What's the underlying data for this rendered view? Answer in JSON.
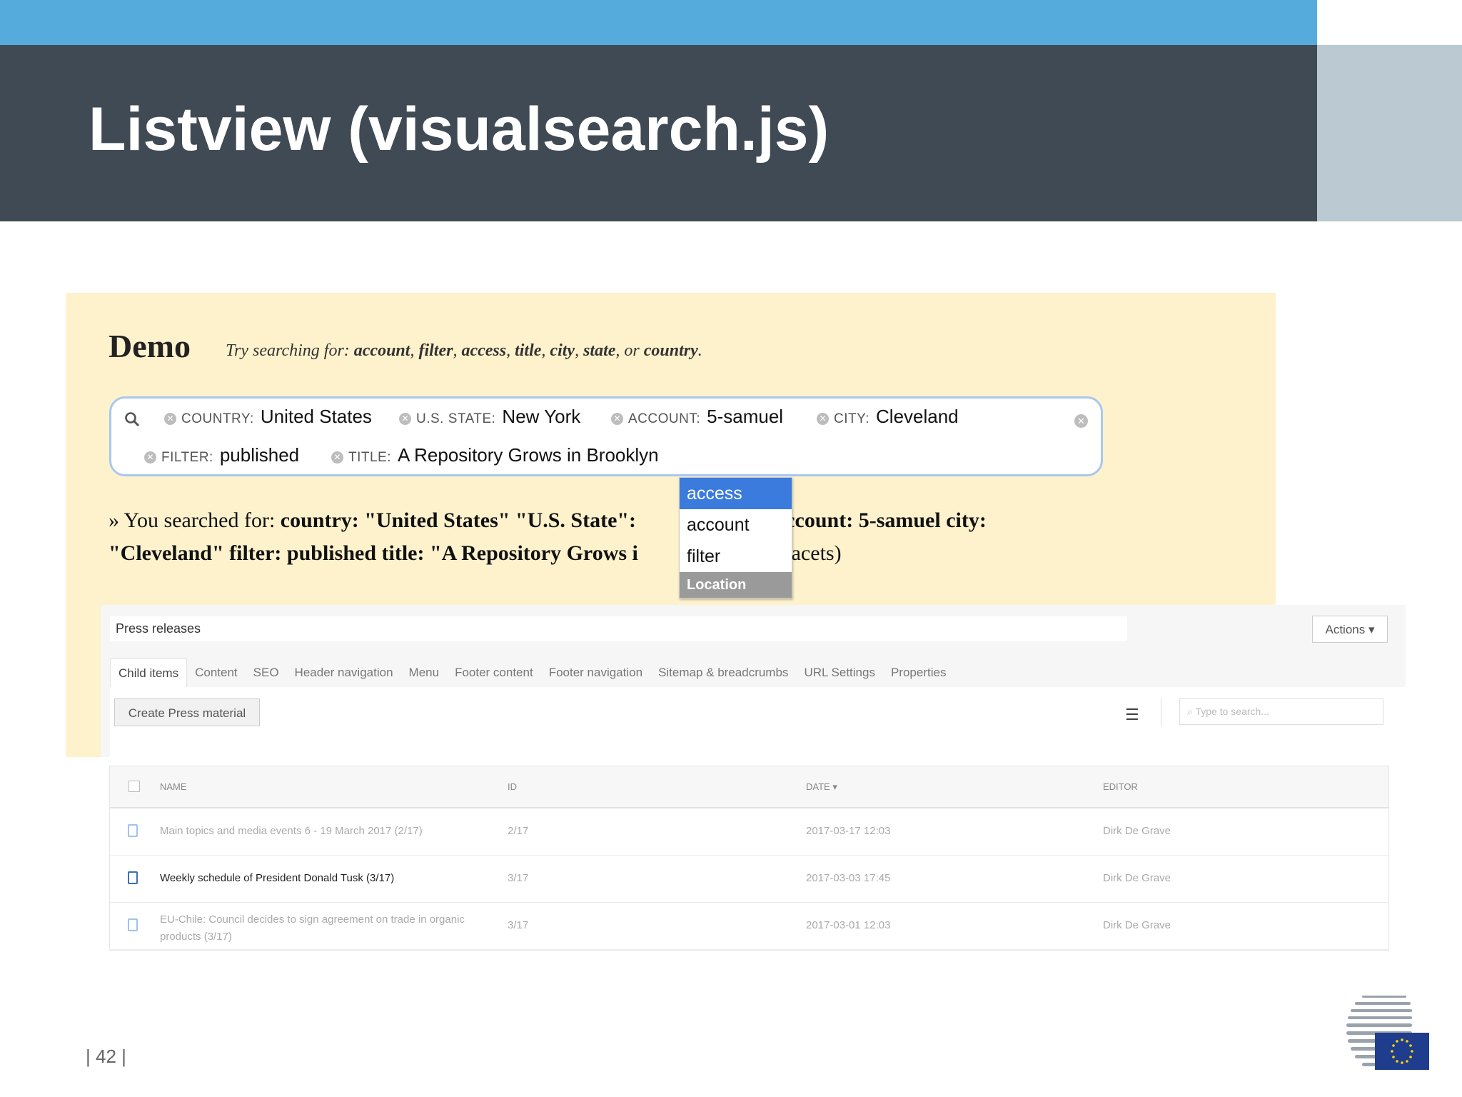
{
  "slide": {
    "title": "Listview (visualsearch.js)",
    "page_number": "| 42 |"
  },
  "demo": {
    "heading": "Demo",
    "hint_prefix": "Try searching for: ",
    "hint_keywords": [
      "account",
      "filter",
      "access",
      "title",
      "city",
      "state"
    ],
    "hint_or": "or",
    "hint_last": "country",
    "facets": [
      {
        "category": "COUNTRY:",
        "value": "United States"
      },
      {
        "category": "U.S. STATE:",
        "value": "New York"
      },
      {
        "category": "ACCOUNT:",
        "value": "5-samuel"
      },
      {
        "category": "CITY:",
        "value": "Cleveland"
      },
      {
        "category": "FILTER:",
        "value": "published"
      },
      {
        "category": "TITLE:",
        "value": "A Repository Grows in Brooklyn"
      }
    ],
    "result_line1_prefix": "» You searched for: ",
    "result_line1_bold": "country: \"United States\" \"U.S. State\":",
    "result_line1_bold2": "\" account: 5-samuel city:",
    "result_line2_bold": "\"Cleveland\" filter: published title: \"A Repository Grows i",
    "result_line2_tail": "\". (6 facets)",
    "autocomplete": {
      "items": [
        "access",
        "account",
        "filter"
      ],
      "active": "access",
      "category": "Location"
    }
  },
  "cms": {
    "title": "Press releases",
    "actions_label": "Actions ▾",
    "tabs": [
      "Child items",
      "Content",
      "SEO",
      "Header navigation",
      "Menu",
      "Footer content",
      "Footer navigation",
      "Sitemap & breadcrumbs",
      "URL Settings",
      "Properties"
    ],
    "active_tab": "Child items",
    "create_button": "Create Press material",
    "search_placeholder": "Type to search...",
    "table": {
      "headers": [
        "Name",
        "ID",
        "Date ▾",
        "Editor"
      ],
      "rows": [
        {
          "name": "Main topics and media events 6 - 19 March 2017 (2/17)",
          "id": "2/17",
          "date": "2017-03-17 12:03",
          "editor": "Dirk De Grave",
          "dark": false
        },
        {
          "name": "Weekly schedule of President Donald Tusk (3/17)",
          "id": "3/17",
          "date": "2017-03-03 17:45",
          "editor": "Dirk De Grave",
          "dark": true
        },
        {
          "name": "EU-Chile: Council decides to sign agreement on trade in organic products (3/17)",
          "id": "3/17",
          "date": "2017-03-01 12:03",
          "editor": "Dirk De Grave",
          "dark": false
        }
      ]
    }
  },
  "colors": {
    "top_strip": "#55acdc",
    "header_band": "#404a54",
    "side_block": "#bac9d2",
    "demo_bg": "#fef2cd",
    "autocomplete_active": "#3a7bdd"
  }
}
